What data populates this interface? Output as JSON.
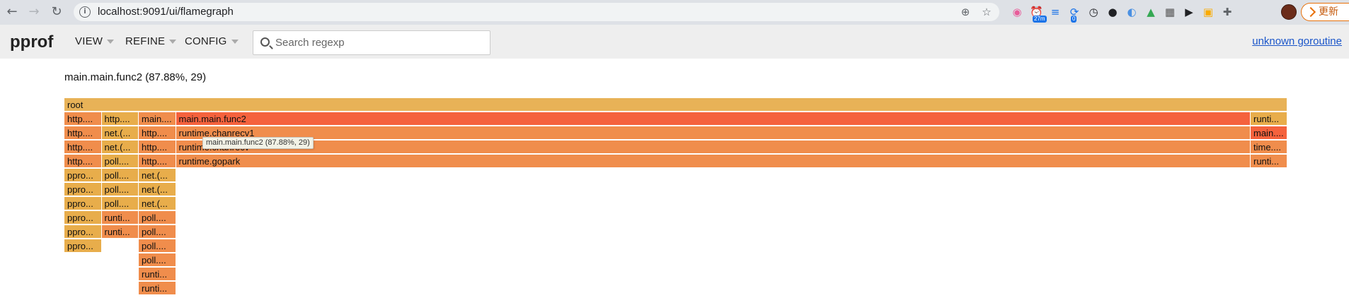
{
  "browser": {
    "url": "localhost:9091/ui/flamegraph",
    "back_glyph": "←",
    "forward_glyph": "→",
    "reload_glyph": "↻",
    "info_glyph": "i",
    "zoom_glyph": "⊕",
    "star_glyph": "☆",
    "extensions": [
      {
        "name": "color-ext",
        "glyph": "◉",
        "color": "#e85c9a"
      },
      {
        "name": "timer-ext",
        "glyph": "⏰",
        "color": "#ea4335",
        "badge": "27m"
      },
      {
        "name": "filter-ext",
        "glyph": "≡",
        "color": "#1a73e8"
      },
      {
        "name": "sync-ext",
        "glyph": "⟳",
        "color": "#1a73e8",
        "badge": "0"
      },
      {
        "name": "clock-ext",
        "glyph": "◷",
        "color": "#202124"
      },
      {
        "name": "github-ext",
        "glyph": "●",
        "color": "#202124"
      },
      {
        "name": "vpn-ext",
        "glyph": "◐",
        "color": "#4a90e2"
      },
      {
        "name": "cap-ext",
        "glyph": "▲",
        "color": "#34a853"
      },
      {
        "name": "qr-ext",
        "glyph": "▦",
        "color": "#555555"
      },
      {
        "name": "video-ext",
        "glyph": "▶",
        "color": "#202124"
      },
      {
        "name": "photo-ext",
        "glyph": "▣",
        "color": "#f9ab00"
      },
      {
        "name": "puzzle-ext",
        "glyph": "✚",
        "color": "#5f6368"
      }
    ],
    "update_label": "更新"
  },
  "header": {
    "logo": "pprof",
    "menus": [
      {
        "label": "VIEW"
      },
      {
        "label": "REFINE"
      },
      {
        "label": "CONFIG"
      }
    ],
    "search_placeholder": "Search regexp",
    "title_link": "unknown goroutine"
  },
  "flamegraph": {
    "details": "main.main.func2 (87.88%, 29)",
    "tooltip": "main.main.func2 (87.88%, 29)",
    "colors": {
      "root": "#e8b257",
      "red": "#f5623d",
      "orange": "#f08d4c",
      "gold": "#e8ad4b"
    },
    "frames": [
      {
        "label": "root",
        "col": 0,
        "span": 33,
        "depth": 0,
        "color": "root"
      },
      {
        "label": "http....",
        "col": 0,
        "span": 1,
        "depth": 1,
        "color": "orange"
      },
      {
        "label": "http....",
        "col": 1,
        "span": 1,
        "depth": 1,
        "color": "gold"
      },
      {
        "label": "main....",
        "col": 2,
        "span": 1,
        "depth": 1,
        "color": "orange"
      },
      {
        "label": "main.main.func2",
        "col": 3,
        "span": 29,
        "depth": 1,
        "color": "red"
      },
      {
        "label": "runti...",
        "col": 32,
        "span": 1,
        "depth": 1,
        "color": "gold"
      },
      {
        "label": "http....",
        "col": 0,
        "span": 1,
        "depth": 2,
        "color": "orange"
      },
      {
        "label": "net.(...",
        "col": 1,
        "span": 1,
        "depth": 2,
        "color": "gold"
      },
      {
        "label": "http....",
        "col": 2,
        "span": 1,
        "depth": 2,
        "color": "orange"
      },
      {
        "label": "runtime.chanrecv1",
        "col": 3,
        "span": 29,
        "depth": 2,
        "color": "orange"
      },
      {
        "label": "main....",
        "col": 32,
        "span": 1,
        "depth": 2,
        "color": "red"
      },
      {
        "label": "http....",
        "col": 0,
        "span": 1,
        "depth": 3,
        "color": "orange"
      },
      {
        "label": "net.(...",
        "col": 1,
        "span": 1,
        "depth": 3,
        "color": "gold"
      },
      {
        "label": "http....",
        "col": 2,
        "span": 1,
        "depth": 3,
        "color": "orange"
      },
      {
        "label": "runtime.chanrecv",
        "col": 3,
        "span": 29,
        "depth": 3,
        "color": "orange"
      },
      {
        "label": "time....",
        "col": 32,
        "span": 1,
        "depth": 3,
        "color": "orange"
      },
      {
        "label": "http....",
        "col": 0,
        "span": 1,
        "depth": 4,
        "color": "orange"
      },
      {
        "label": "poll....",
        "col": 1,
        "span": 1,
        "depth": 4,
        "color": "gold"
      },
      {
        "label": "http....",
        "col": 2,
        "span": 1,
        "depth": 4,
        "color": "orange"
      },
      {
        "label": "runtime.gopark",
        "col": 3,
        "span": 29,
        "depth": 4,
        "color": "orange"
      },
      {
        "label": "runti...",
        "col": 32,
        "span": 1,
        "depth": 4,
        "color": "orange"
      },
      {
        "label": "ppro...",
        "col": 0,
        "span": 1,
        "depth": 5,
        "color": "gold"
      },
      {
        "label": "poll....",
        "col": 1,
        "span": 1,
        "depth": 5,
        "color": "gold"
      },
      {
        "label": "net.(...",
        "col": 2,
        "span": 1,
        "depth": 5,
        "color": "gold"
      },
      {
        "label": "ppro...",
        "col": 0,
        "span": 1,
        "depth": 6,
        "color": "gold"
      },
      {
        "label": "poll....",
        "col": 1,
        "span": 1,
        "depth": 6,
        "color": "gold"
      },
      {
        "label": "net.(...",
        "col": 2,
        "span": 1,
        "depth": 6,
        "color": "gold"
      },
      {
        "label": "ppro...",
        "col": 0,
        "span": 1,
        "depth": 7,
        "color": "gold"
      },
      {
        "label": "poll....",
        "col": 1,
        "span": 1,
        "depth": 7,
        "color": "gold"
      },
      {
        "label": "net.(...",
        "col": 2,
        "span": 1,
        "depth": 7,
        "color": "gold"
      },
      {
        "label": "ppro...",
        "col": 0,
        "span": 1,
        "depth": 8,
        "color": "gold"
      },
      {
        "label": "runti...",
        "col": 1,
        "span": 1,
        "depth": 8,
        "color": "orange"
      },
      {
        "label": "poll....",
        "col": 2,
        "span": 1,
        "depth": 8,
        "color": "orange"
      },
      {
        "label": "ppro...",
        "col": 0,
        "span": 1,
        "depth": 9,
        "color": "gold"
      },
      {
        "label": "runti...",
        "col": 1,
        "span": 1,
        "depth": 9,
        "color": "orange"
      },
      {
        "label": "poll....",
        "col": 2,
        "span": 1,
        "depth": 9,
        "color": "orange"
      },
      {
        "label": "ppro...",
        "col": 0,
        "span": 1,
        "depth": 10,
        "color": "gold"
      },
      {
        "label": "poll....",
        "col": 2,
        "span": 1,
        "depth": 10,
        "color": "orange"
      },
      {
        "label": "poll....",
        "col": 2,
        "span": 1,
        "depth": 11,
        "color": "orange"
      },
      {
        "label": "runti...",
        "col": 2,
        "span": 1,
        "depth": 12,
        "color": "orange"
      },
      {
        "label": "runti...",
        "col": 2,
        "span": 1,
        "depth": 13,
        "color": "orange"
      }
    ]
  }
}
